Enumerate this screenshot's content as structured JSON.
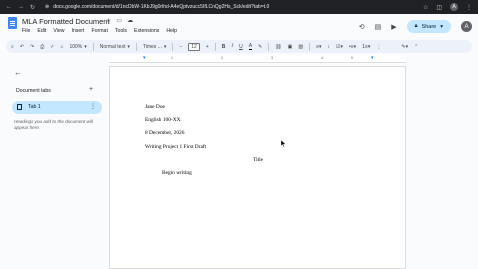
{
  "browser": {
    "url": "docs.google.com/document/d/1ncDbW-1KbJ9g0rlhd-A4eQptvzucc5IfLCnQg2Hs_Sck/edit?tab=t.0"
  },
  "document": {
    "title": "MLA Formatted Document",
    "menu": [
      "File",
      "Edit",
      "View",
      "Insert",
      "Format",
      "Tools",
      "Extensions",
      "Help"
    ],
    "share_label": "Share",
    "user_initial": "A"
  },
  "toolbar": {
    "zoom": "100%",
    "style": "Normal text",
    "font": "Times ...",
    "font_size": "12"
  },
  "sidebar": {
    "heading": "Document tabs",
    "tab_label": "Tab 1",
    "hint": "Headings you add to the document will appear here."
  },
  "page": {
    "lines": [
      "Jane Doe",
      "English 100-XX",
      "8 December, 2026",
      "Writing Project 1 First Draft",
      "Title",
      "Begin writing"
    ]
  },
  "colors": {
    "accent": "#1a73e8",
    "share_bg": "#c2e7ff",
    "tab_bg": "#c2e7ff",
    "toolbar_bg": "#edf2fa"
  }
}
